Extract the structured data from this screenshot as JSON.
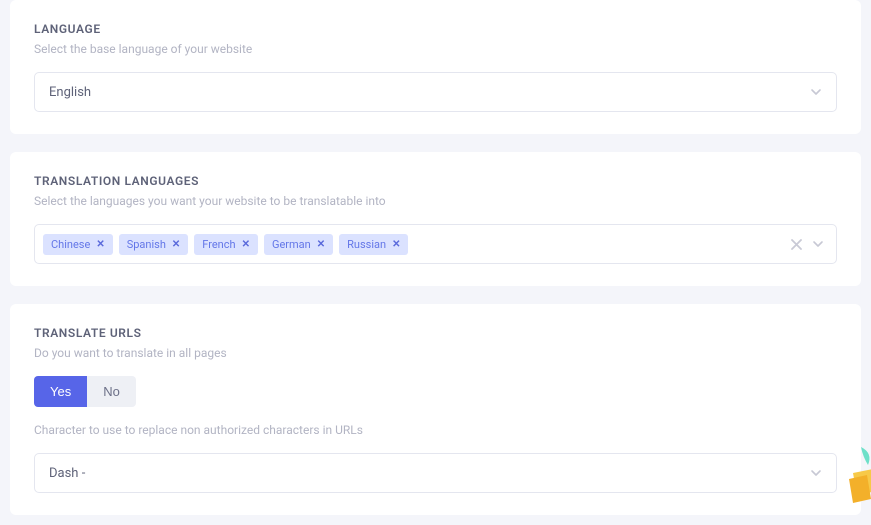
{
  "language": {
    "title": "LANGUAGE",
    "desc": "Select the base language of your website",
    "value": "English"
  },
  "translation": {
    "title": "TRANSLATION LANGUAGES",
    "desc": "Select the languages you want your website to be translatable into",
    "tags": [
      "Chinese",
      "Spanish",
      "French",
      "German",
      "Russian"
    ]
  },
  "urls": {
    "title": "TRANSLATE URLS",
    "desc": "Do you want to translate in all pages",
    "yes": "Yes",
    "no": "No",
    "selected": "Yes",
    "char_desc": "Character to use to replace non authorized characters in URLs",
    "char_value": "Dash -"
  }
}
